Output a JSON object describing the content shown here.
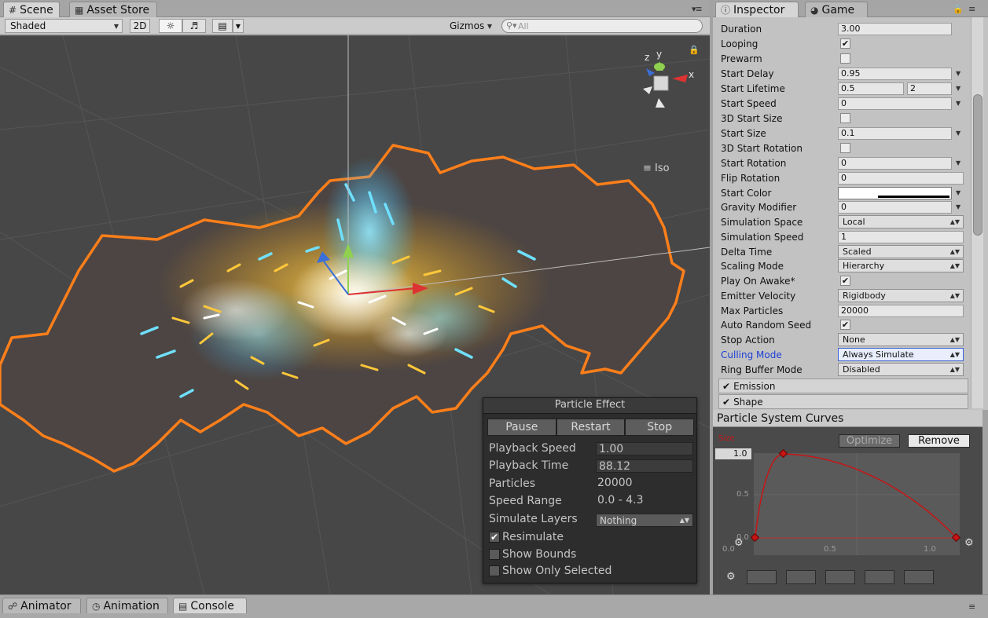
{
  "scene_panel": {
    "tabs": [
      {
        "label": "Scene",
        "icon": "grid-icon"
      },
      {
        "label": "Asset Store",
        "icon": "shop-icon"
      }
    ],
    "toolbar": {
      "shading_mode": "Shaded",
      "mode_2d": "2D",
      "gizmos": "Gizmos",
      "search_placeholder": "All"
    },
    "gizmo": {
      "x": "x",
      "y": "y",
      "z": "z",
      "view": "Iso"
    }
  },
  "particle_effect": {
    "title": "Particle Effect",
    "buttons": [
      "Pause",
      "Restart",
      "Stop"
    ],
    "playback_speed_label": "Playback Speed",
    "playback_speed": "1.00",
    "playback_time_label": "Playback Time",
    "playback_time": "88.12",
    "particles_label": "Particles",
    "particles": "20000",
    "speed_range_label": "Speed Range",
    "speed_range": "0.0 - 4.3",
    "simulate_layers_label": "Simulate Layers",
    "simulate_layers": "Nothing",
    "resimulate": "Resimulate",
    "show_bounds": "Show Bounds",
    "show_only_selected": "Show Only Selected"
  },
  "inspector": {
    "tabs": [
      {
        "label": "Inspector",
        "icon": "info-icon"
      },
      {
        "label": "Game",
        "icon": "pacman-icon"
      }
    ],
    "props": {
      "duration": {
        "label": "Duration",
        "value": "3.00"
      },
      "looping": {
        "label": "Looping",
        "checked": true
      },
      "prewarm": {
        "label": "Prewarm",
        "checked": false
      },
      "start_delay": {
        "label": "Start Delay",
        "value": "0.95"
      },
      "start_lifetime": {
        "label": "Start Lifetime",
        "min": "0.5",
        "max": "2"
      },
      "start_speed": {
        "label": "Start Speed",
        "value": "0"
      },
      "start_size_3d": {
        "label": "3D Start Size",
        "checked": false
      },
      "start_size": {
        "label": "Start Size",
        "value": "0.1"
      },
      "start_rotation_3d": {
        "label": "3D Start Rotation",
        "checked": false
      },
      "start_rotation": {
        "label": "Start Rotation",
        "value": "0"
      },
      "flip_rotation": {
        "label": "Flip Rotation",
        "value": "0"
      },
      "start_color": {
        "label": "Start Color"
      },
      "gravity_modifier": {
        "label": "Gravity Modifier",
        "value": "0"
      },
      "simulation_space": {
        "label": "Simulation Space",
        "value": "Local"
      },
      "simulation_speed": {
        "label": "Simulation Speed",
        "value": "1"
      },
      "delta_time": {
        "label": "Delta Time",
        "value": "Scaled"
      },
      "scaling_mode": {
        "label": "Scaling Mode",
        "value": "Hierarchy"
      },
      "play_on_awake": {
        "label": "Play On Awake*",
        "checked": true
      },
      "emitter_velocity": {
        "label": "Emitter Velocity",
        "value": "Rigidbody"
      },
      "max_particles": {
        "label": "Max Particles",
        "value": "20000"
      },
      "auto_random_seed": {
        "label": "Auto Random Seed",
        "checked": true
      },
      "stop_action": {
        "label": "Stop Action",
        "value": "None"
      },
      "culling_mode": {
        "label": "Culling Mode",
        "value": "Always Simulate"
      },
      "ring_buffer_mode": {
        "label": "Ring Buffer Mode",
        "value": "Disabled"
      }
    },
    "modules": [
      "Emission",
      "Shape"
    ]
  },
  "curves": {
    "title": "Particle System Curves",
    "optimize": "Optimize",
    "remove": "Remove",
    "curve_label": "Size",
    "y_value": "1.0",
    "y_mid": "0.5",
    "y_low": "0.0",
    "x_ticks": [
      "0.0",
      "0.5",
      "1.0"
    ]
  },
  "bottom_tabs": [
    {
      "label": "Animator",
      "icon": "animator-icon"
    },
    {
      "label": "Animation",
      "icon": "clock-icon"
    },
    {
      "label": "Console",
      "icon": "console-icon"
    }
  ],
  "colors": {
    "viewport_bg": "#474747",
    "selection_outline": "#ff7f1a",
    "curve_red": "#c81414",
    "focus_blue": "#3c62d6"
  }
}
